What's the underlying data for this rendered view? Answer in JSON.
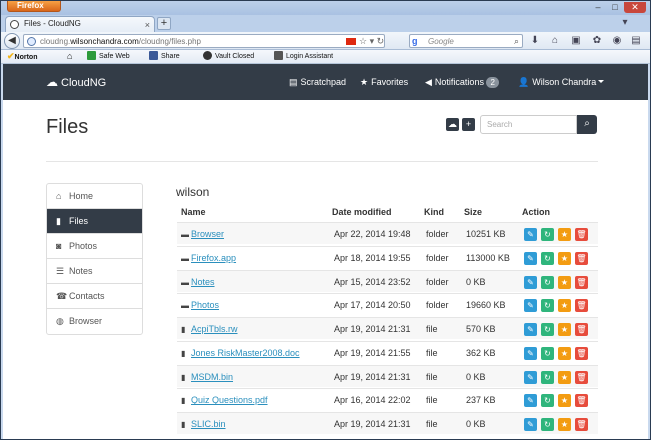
{
  "browser": {
    "menu_button": "Firefox",
    "tab_title": "Files - CloudNG",
    "url_prefix": "cloudng.",
    "url_domain": "wilsonchandra.com",
    "url_path": "/cloudng/files.php",
    "search_engine": "Google",
    "search_placeholder": "Google"
  },
  "bookmarks": [
    {
      "label": "Norton",
      "icon": "norton-check-icon"
    },
    {
      "label": "",
      "icon": "home-icon"
    },
    {
      "label": "Safe Web",
      "icon": "safe-web-icon"
    },
    {
      "label": "Share",
      "icon": "facebook-icon"
    },
    {
      "label": "Vault Closed",
      "icon": "vault-icon"
    },
    {
      "label": "Login Assistant",
      "icon": "login-icon"
    }
  ],
  "app": {
    "brand": "CloudNG",
    "nav": [
      {
        "label": "Scratchpad",
        "icon": "list-icon"
      },
      {
        "label": "Favorites",
        "icon": "star-icon"
      },
      {
        "label": "Notifications",
        "icon": "bullhorn-icon",
        "badge": "2"
      },
      {
        "label": "Wilson Chandra",
        "icon": "user-icon"
      }
    ],
    "page_title": "Files",
    "search_placeholder": "Search",
    "sidebar": [
      {
        "label": "Home",
        "icon": "home-icon",
        "active": false
      },
      {
        "label": "Files",
        "icon": "file-icon",
        "active": true
      },
      {
        "label": "Photos",
        "icon": "camera-icon",
        "active": false
      },
      {
        "label": "Notes",
        "icon": "notes-icon",
        "active": false
      },
      {
        "label": "Contacts",
        "icon": "phone-icon",
        "active": false
      },
      {
        "label": "Browser",
        "icon": "globe-icon",
        "active": false
      }
    ],
    "folder": "wilson",
    "columns": [
      "Name",
      "Date modified",
      "Kind",
      "Size",
      "Action"
    ],
    "rows": [
      {
        "name": "Browser",
        "date": "Apr 22, 2014 19:48",
        "kind": "folder",
        "size": "10251 KB"
      },
      {
        "name": "Firefox.app",
        "date": "Apr 18, 2014 19:55",
        "kind": "folder",
        "size": "113000 KB"
      },
      {
        "name": "Notes",
        "date": "Apr 15, 2014 23:52",
        "kind": "folder",
        "size": "0 KB"
      },
      {
        "name": "Photos",
        "date": "Apr 17, 2014 20:50",
        "kind": "folder",
        "size": "19660 KB"
      },
      {
        "name": "AcpiTbls.rw",
        "date": "Apr 19, 2014 21:31",
        "kind": "file",
        "size": "570 KB"
      },
      {
        "name": "Jones RiskMaster2008.doc",
        "date": "Apr 19, 2014 21:55",
        "kind": "file",
        "size": "362 KB"
      },
      {
        "name": "MSDM.bin",
        "date": "Apr 19, 2014 21:31",
        "kind": "file",
        "size": "0 KB"
      },
      {
        "name": "Quiz Questions.pdf",
        "date": "Apr 16, 2014 22:02",
        "kind": "file",
        "size": "237 KB"
      },
      {
        "name": "SLIC.bin",
        "date": "Apr 19, 2014 21:31",
        "kind": "file",
        "size": "0 KB"
      }
    ]
  }
}
